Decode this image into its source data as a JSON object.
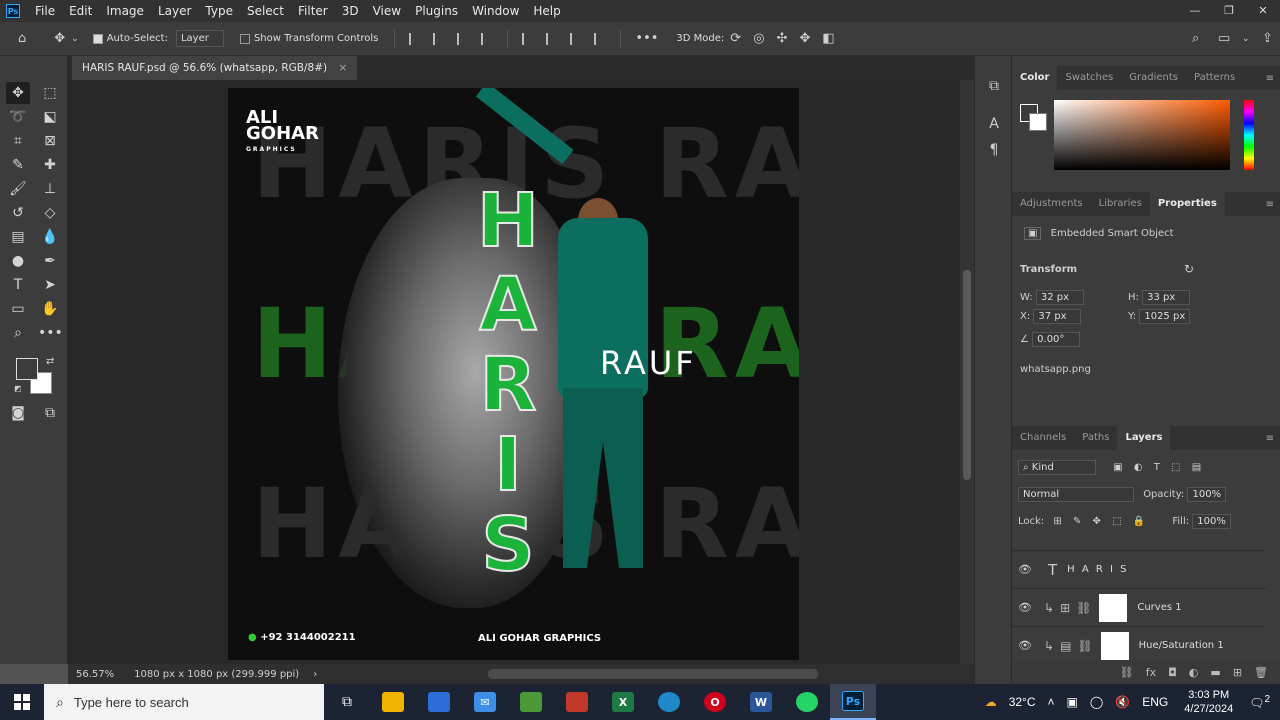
{
  "app": {
    "logo": "Ps",
    "menu": [
      "File",
      "Edit",
      "Image",
      "Layer",
      "Type",
      "Select",
      "Filter",
      "3D",
      "View",
      "Plugins",
      "Window",
      "Help"
    ]
  },
  "options_bar": {
    "auto_select_label": "Auto-Select:",
    "auto_select_value": "Layer",
    "show_transform_label": "Show Transform Controls",
    "mode_3d_label": "3D Mode:"
  },
  "document": {
    "tab_title": "HARIS RAUF.psd @ 56.6% (whatsapp, RGB/8#)",
    "close_symbol": "×"
  },
  "artwork": {
    "bg_text": "HARIS RAUF",
    "name_letters": [
      "H",
      "A",
      "R",
      "I",
      "S"
    ],
    "rauf_text": "RAUF",
    "logo_line1": "ALI",
    "logo_line2": "GOHAR",
    "logo_line3": "GRAPHICS",
    "phone": "+92 3144002211",
    "brand": "ALI GOHAR GRAPHICS"
  },
  "status": {
    "zoom": "56.57%",
    "doc_size": "1080 px x 1080 px (299.999 ppi)"
  },
  "color_panel": {
    "tabs": [
      "Color",
      "Swatches",
      "Gradients",
      "Patterns"
    ],
    "active_tab": "Color"
  },
  "properties_panel": {
    "tabs": [
      "Adjustments",
      "Libraries",
      "Properties"
    ],
    "active_tab": "Properties",
    "object_type": "Embedded Smart Object",
    "section": "Transform",
    "w_label": "W:",
    "w_value": "32 px",
    "h_label": "H:",
    "h_value": "33 px",
    "x_label": "X:",
    "x_value": "37 px",
    "y_label": "Y:",
    "y_value": "1025 px",
    "angle_value": "0.00°",
    "linked_file": "whatsapp.png"
  },
  "layers_panel": {
    "tabs": [
      "Channels",
      "Paths",
      "Layers"
    ],
    "active_tab": "Layers",
    "kind_label": "Kind",
    "blend_mode": "Normal",
    "opacity_label": "Opacity:",
    "opacity_value": "100%",
    "lock_label": "Lock:",
    "fill_label": "Fill:",
    "fill_value": "100%",
    "layers": [
      {
        "name": "H A R I S",
        "type": "text"
      },
      {
        "name": "Curves 1",
        "type": "adjustment"
      },
      {
        "name": "Hue/Saturation 1",
        "type": "adjustment"
      }
    ]
  },
  "taskbar": {
    "search_placeholder": "Type here to search",
    "weather": "32°C",
    "lang": "ENG",
    "time": "3:03 PM",
    "date": "4/27/2024",
    "notification_count": "2"
  }
}
